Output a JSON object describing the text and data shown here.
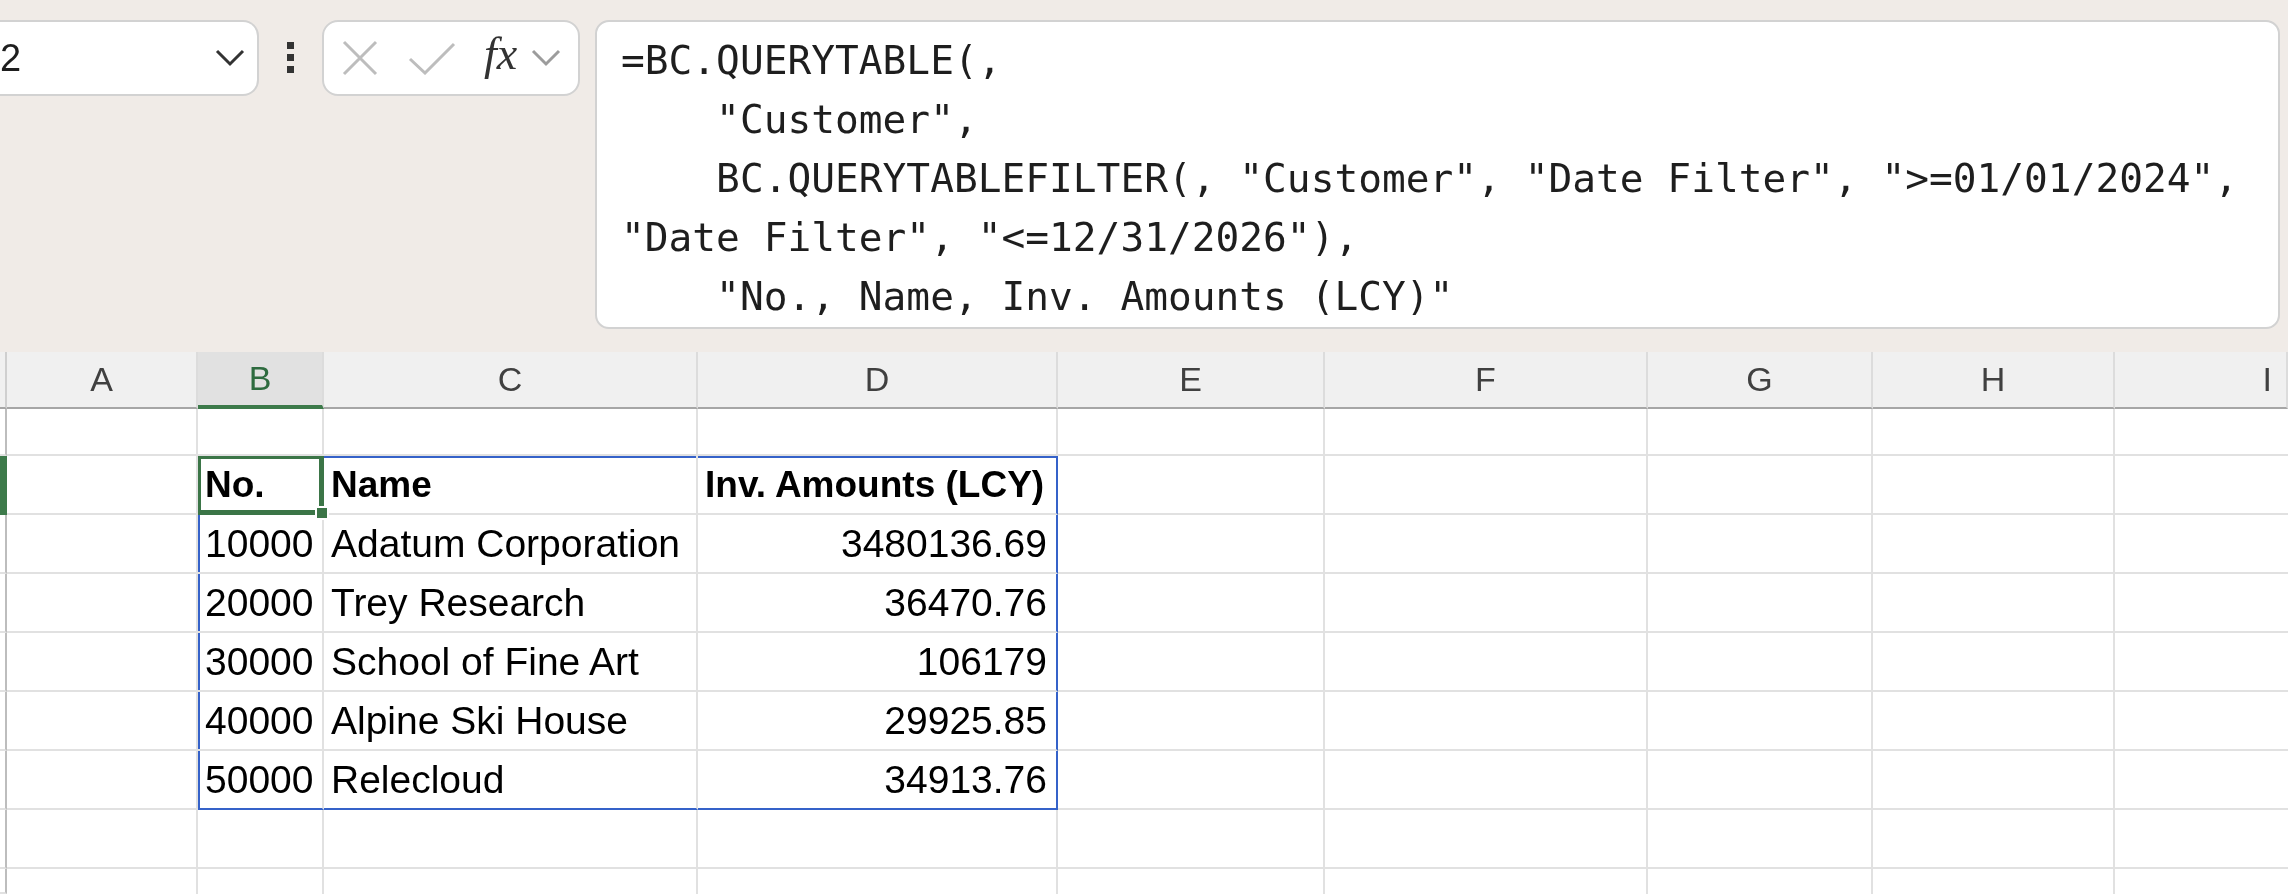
{
  "name_box": {
    "value": "2"
  },
  "formula_buttons": [
    {
      "kind": "cancel",
      "disabled": true
    },
    {
      "kind": "enter",
      "disabled": true
    },
    {
      "kind": "function",
      "label": "fx",
      "disabled": false
    },
    {
      "kind": "expand",
      "disabled": false
    }
  ],
  "formula_bar": {
    "lines": [
      "=BC.QUERYTABLE(,",
      "    \"Customer\",",
      "    BC.QUERYTABLEFILTER(, \"Customer\", \"Date Filter\", \">=01/01/2024\",",
      "\"Date Filter\", \"<=12/31/2026\"),",
      "    \"No., Name, Inv. Amounts (LCY)\""
    ]
  },
  "sheet": {
    "columns": [
      {
        "label": "A",
        "selected": false
      },
      {
        "label": "B",
        "selected": true
      },
      {
        "label": "C",
        "selected": false
      },
      {
        "label": "D",
        "selected": false
      },
      {
        "label": "E",
        "selected": false
      },
      {
        "label": "F",
        "selected": false
      },
      {
        "label": "G",
        "selected": false
      },
      {
        "label": "H",
        "selected": false
      },
      {
        "label": "I",
        "selected": false
      }
    ],
    "rows": [
      {
        "selected": false
      },
      {
        "selected": true
      },
      {
        "selected": false
      },
      {
        "selected": false
      },
      {
        "selected": false
      },
      {
        "selected": false
      },
      {
        "selected": false
      },
      {
        "selected": false
      },
      {
        "selected": false
      }
    ]
  },
  "table": {
    "header": [
      {
        "text": "No.",
        "selected": true
      },
      {
        "text": "Name",
        "selected": false
      },
      {
        "text": "Inv. Amounts (LCY)",
        "selected": false
      }
    ],
    "rows": [
      {
        "cells": [
          {
            "text": "10000",
            "kind": "text",
            "selected": false
          },
          {
            "text": "Adatum Corporation",
            "kind": "text",
            "selected": false
          },
          {
            "text": "3480136.69",
            "kind": "number",
            "selected": false
          }
        ]
      },
      {
        "cells": [
          {
            "text": "20000",
            "kind": "text",
            "selected": false
          },
          {
            "text": "Trey Research",
            "kind": "text",
            "selected": false
          },
          {
            "text": "36470.76",
            "kind": "number",
            "selected": false
          }
        ]
      },
      {
        "cells": [
          {
            "text": "30000",
            "kind": "text",
            "selected": false
          },
          {
            "text": "School of Fine Art",
            "kind": "text",
            "selected": false
          },
          {
            "text": "106179",
            "kind": "number",
            "selected": false
          }
        ]
      },
      {
        "cells": [
          {
            "text": "40000",
            "kind": "text",
            "selected": false
          },
          {
            "text": "Alpine Ski House",
            "kind": "text",
            "selected": false
          },
          {
            "text": "29925.85",
            "kind": "number",
            "selected": false
          }
        ]
      },
      {
        "cells": [
          {
            "text": "50000",
            "kind": "text",
            "selected": false
          },
          {
            "text": "Relecloud",
            "kind": "text",
            "selected": false
          },
          {
            "text": "34913.76",
            "kind": "number",
            "selected": false
          }
        ]
      }
    ]
  }
}
